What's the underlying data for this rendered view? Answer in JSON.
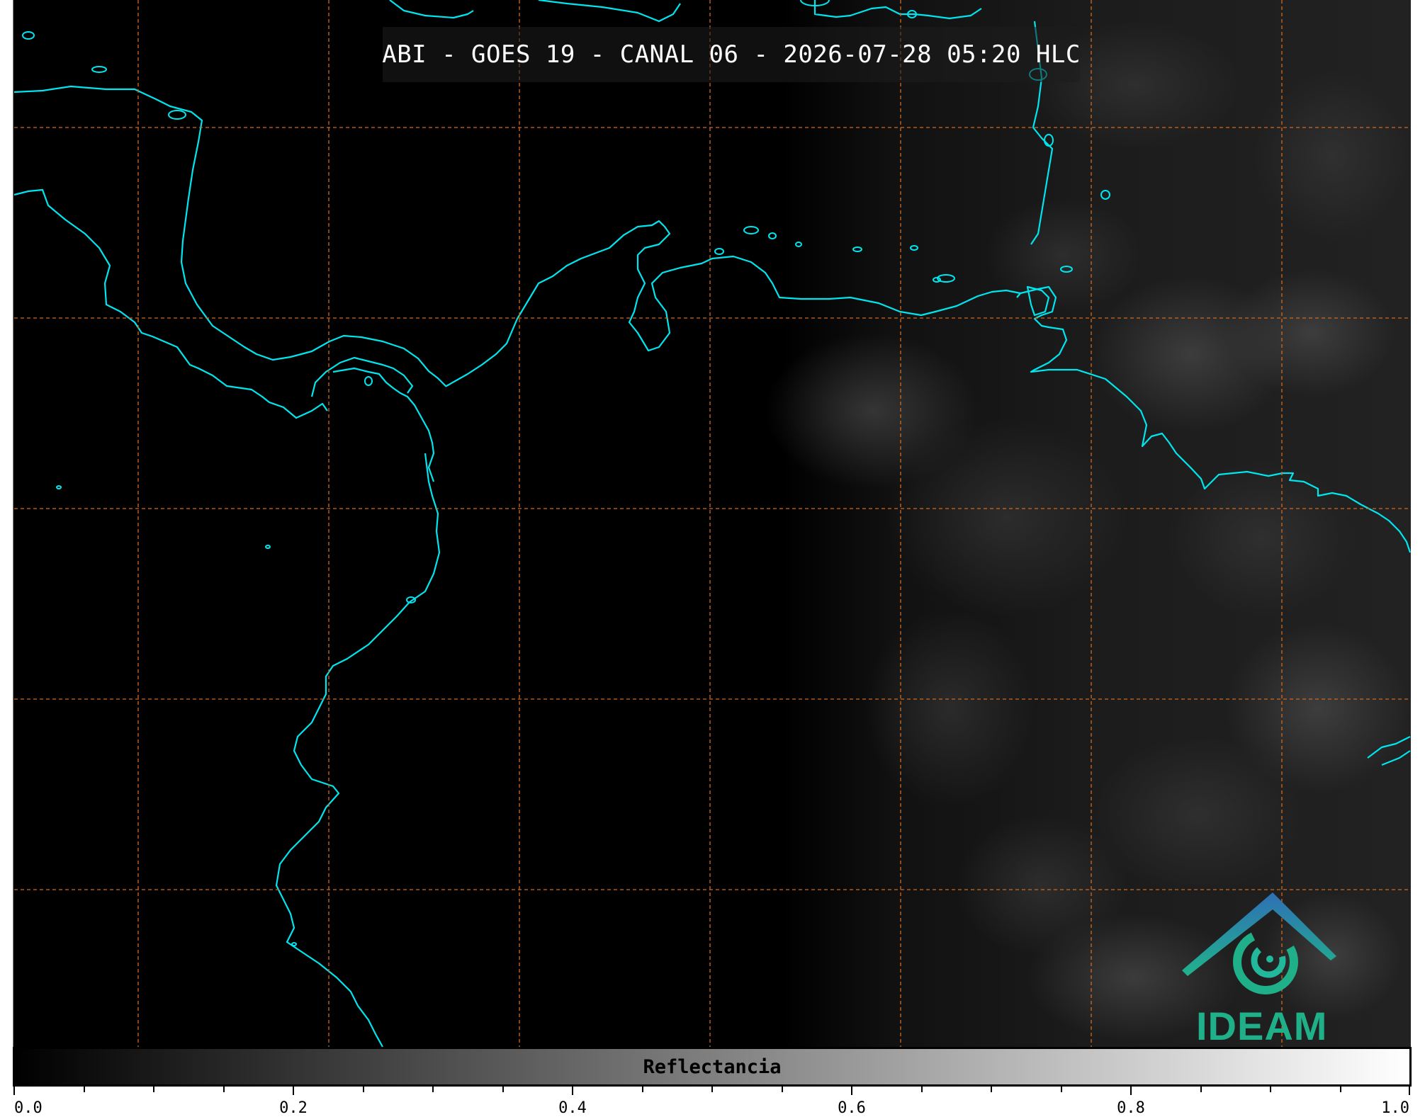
{
  "title": "ABI - GOES 19 - CANAL 06 - 2026-07-28 05:20 HLC",
  "colorbar": {
    "label": "Reflectancia",
    "min": 0.0,
    "max": 1.0,
    "ticks": [
      "0.0",
      "0.2",
      "0.4",
      "0.6",
      "0.8",
      "1.0"
    ],
    "colormap_start": "#000000",
    "colormap_end": "#ffffff"
  },
  "logo": {
    "text": "IDEAM",
    "color": "#1fb08a",
    "roof_color": "#2f6fb5"
  },
  "colors": {
    "coastline": "#00e5ee",
    "gridline": "#d2691e",
    "background": "#000000"
  }
}
